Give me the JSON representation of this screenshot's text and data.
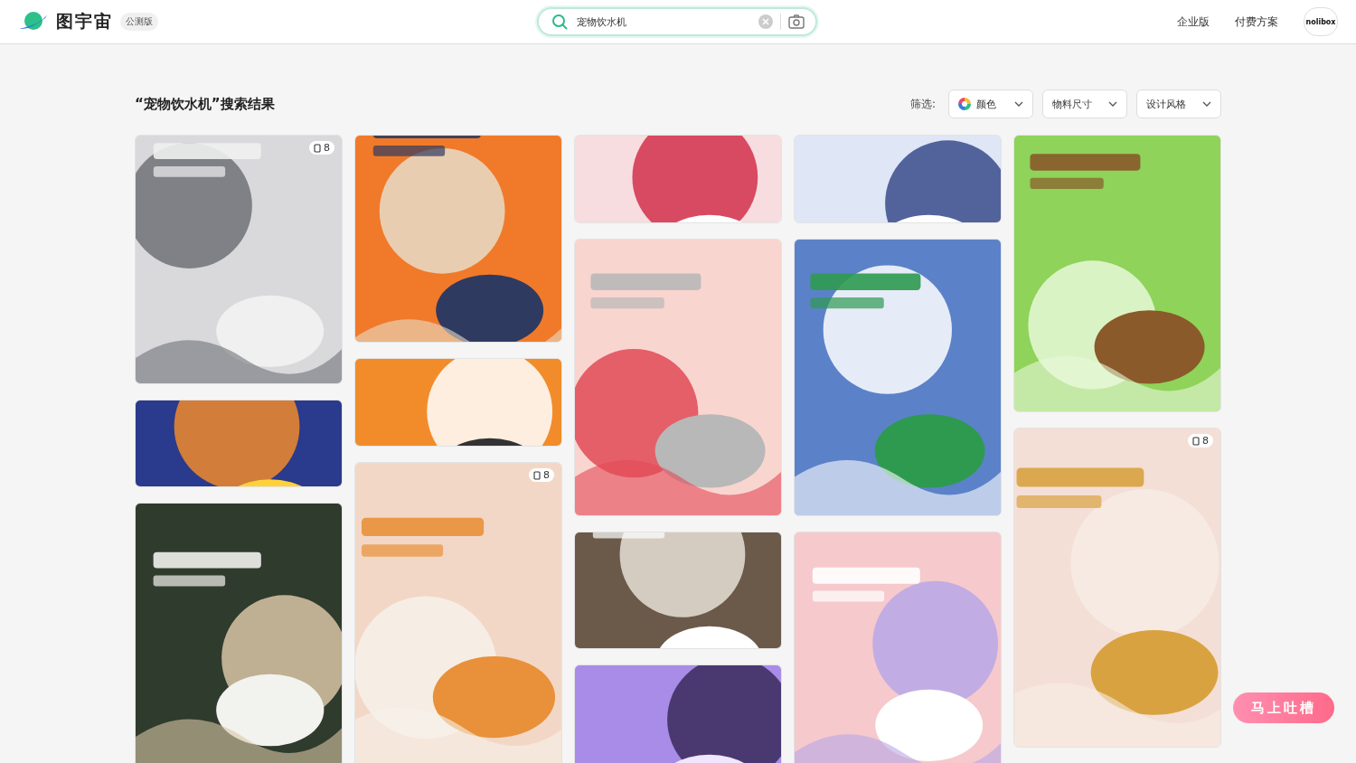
{
  "header": {
    "logo_text": "图宇宙",
    "beta_badge": "公测版",
    "search": {
      "value": "宠物饮水机"
    },
    "nav": [
      "企业版",
      "付费方案"
    ],
    "avatar_text": "nolibox"
  },
  "results": {
    "title": "“宠物饮水机”搜索结果",
    "filter_label": "筛选:",
    "filters": [
      {
        "label": "颜色",
        "kind": "color"
      },
      {
        "label": "物料尺寸",
        "kind": "plain"
      },
      {
        "label": "设计风格",
        "kind": "plain"
      }
    ]
  },
  "columns": [
    [
      {
        "kind": "picture",
        "badge": "8"
      },
      {
        "kind": "picture"
      },
      {
        "kind": "picture"
      }
    ],
    [
      {
        "kind": "picture"
      },
      {
        "kind": "picture"
      },
      {
        "kind": "picture",
        "badge": "8"
      }
    ],
    [
      {
        "kind": "picture"
      },
      {
        "kind": "picture"
      },
      {
        "kind": "picture"
      },
      {
        "kind": "picture"
      }
    ],
    [
      {
        "kind": "picture"
      },
      {
        "kind": "picture"
      },
      {
        "kind": "picture"
      }
    ],
    [
      {
        "kind": "picture"
      },
      {
        "kind": "picture",
        "badge": "8"
      }
    ]
  ],
  "feedback_button": "马上吐槽"
}
